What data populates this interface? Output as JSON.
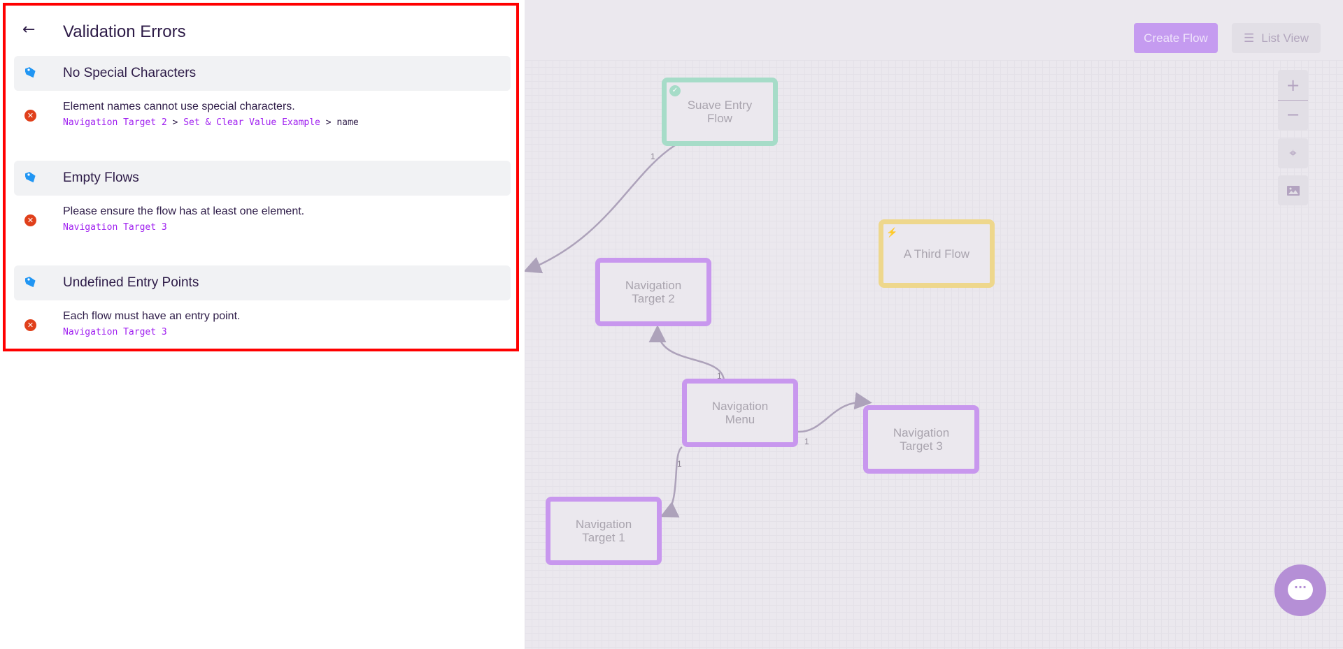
{
  "panel": {
    "title": "Validation Errors",
    "categories": [
      {
        "label": "No Special Characters",
        "errors": [
          {
            "message": "Element names cannot use special characters.",
            "path": [
              "Navigation Target 2",
              "Set & Clear Value Example"
            ],
            "leaf": "name"
          }
        ]
      },
      {
        "label": "Empty Flows",
        "errors": [
          {
            "message": "Please ensure the flow has at least one element.",
            "path": [
              "Navigation Target 3"
            ]
          }
        ]
      },
      {
        "label": "Undefined Entry Points",
        "errors": [
          {
            "message": "Each flow must have an entry point.",
            "path": [
              "Navigation Target 3"
            ]
          }
        ]
      }
    ],
    "separator": ">"
  },
  "toolbar": {
    "create_flow": "Create Flow",
    "list_view": "List View"
  },
  "zoom_controls": {
    "zoom_in": "+",
    "zoom_out": "−"
  },
  "nodes": [
    {
      "label": "Suave Entry Flow",
      "color": "#a6dcc8",
      "icon": "check-circle-icon"
    },
    {
      "label": "A Third Flow",
      "color": "#eed78c",
      "icon": "lightning-icon"
    },
    {
      "label": "Navigation Target 2",
      "color": "#c897ee"
    },
    {
      "label": "Navigation Menu",
      "color": "#c897ee"
    },
    {
      "label": "Navigation Target 3",
      "color": "#c897ee"
    },
    {
      "label": "Navigation Target 1",
      "color": "#c897ee"
    }
  ],
  "edge_labels": [
    "1",
    "1",
    "1",
    "1"
  ],
  "colors": {
    "accent": "#c59bf0",
    "error": "#e0401b",
    "tag": "#2196f3",
    "path": "#a020f0",
    "text": "#2d1b47"
  }
}
